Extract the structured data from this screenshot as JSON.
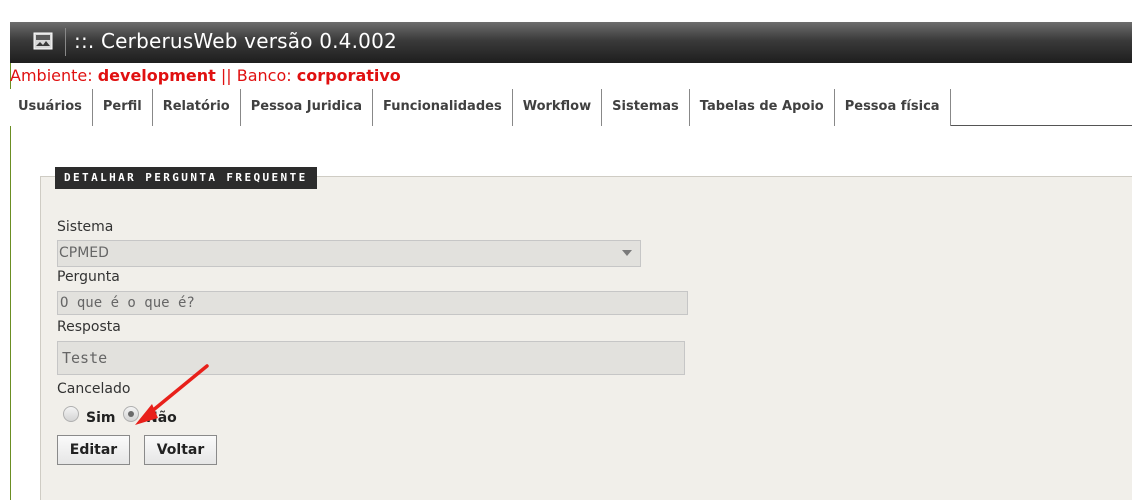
{
  "window": {
    "title": "::.  CerberusWeb versão 0.4.002",
    "icon": "app-window-icon"
  },
  "environment": {
    "env_label": "Ambiente: ",
    "env_value": "development",
    "separator": " || ",
    "db_label": "Banco: ",
    "db_value": "corporativo",
    "color": "#e01010"
  },
  "nav": {
    "items": [
      {
        "label": "Usuários"
      },
      {
        "label": "Perfil"
      },
      {
        "label": "Relatório"
      },
      {
        "label": "Pessoa Juridica"
      },
      {
        "label": "Funcionalidades"
      },
      {
        "label": "Workflow"
      },
      {
        "label": "Sistemas"
      },
      {
        "label": "Tabelas de Apoio"
      },
      {
        "label": "Pessoa física"
      }
    ]
  },
  "form": {
    "legend": "DETALHAR PERGUNTA FREQUENTE",
    "sistema": {
      "label": "Sistema",
      "value": "CPMED"
    },
    "pergunta": {
      "label": "Pergunta",
      "value": "O que é o que é?"
    },
    "resposta": {
      "label": "Resposta",
      "value": "Teste"
    },
    "cancelado": {
      "label": "Cancelado",
      "options": [
        {
          "label": "Sim",
          "checked": false
        },
        {
          "label": "Não",
          "checked": true
        }
      ]
    },
    "buttons": {
      "edit": "Editar",
      "back": "Voltar"
    }
  },
  "annotation": {
    "color": "#e8201a",
    "icon": "red-arrow-annotation"
  }
}
